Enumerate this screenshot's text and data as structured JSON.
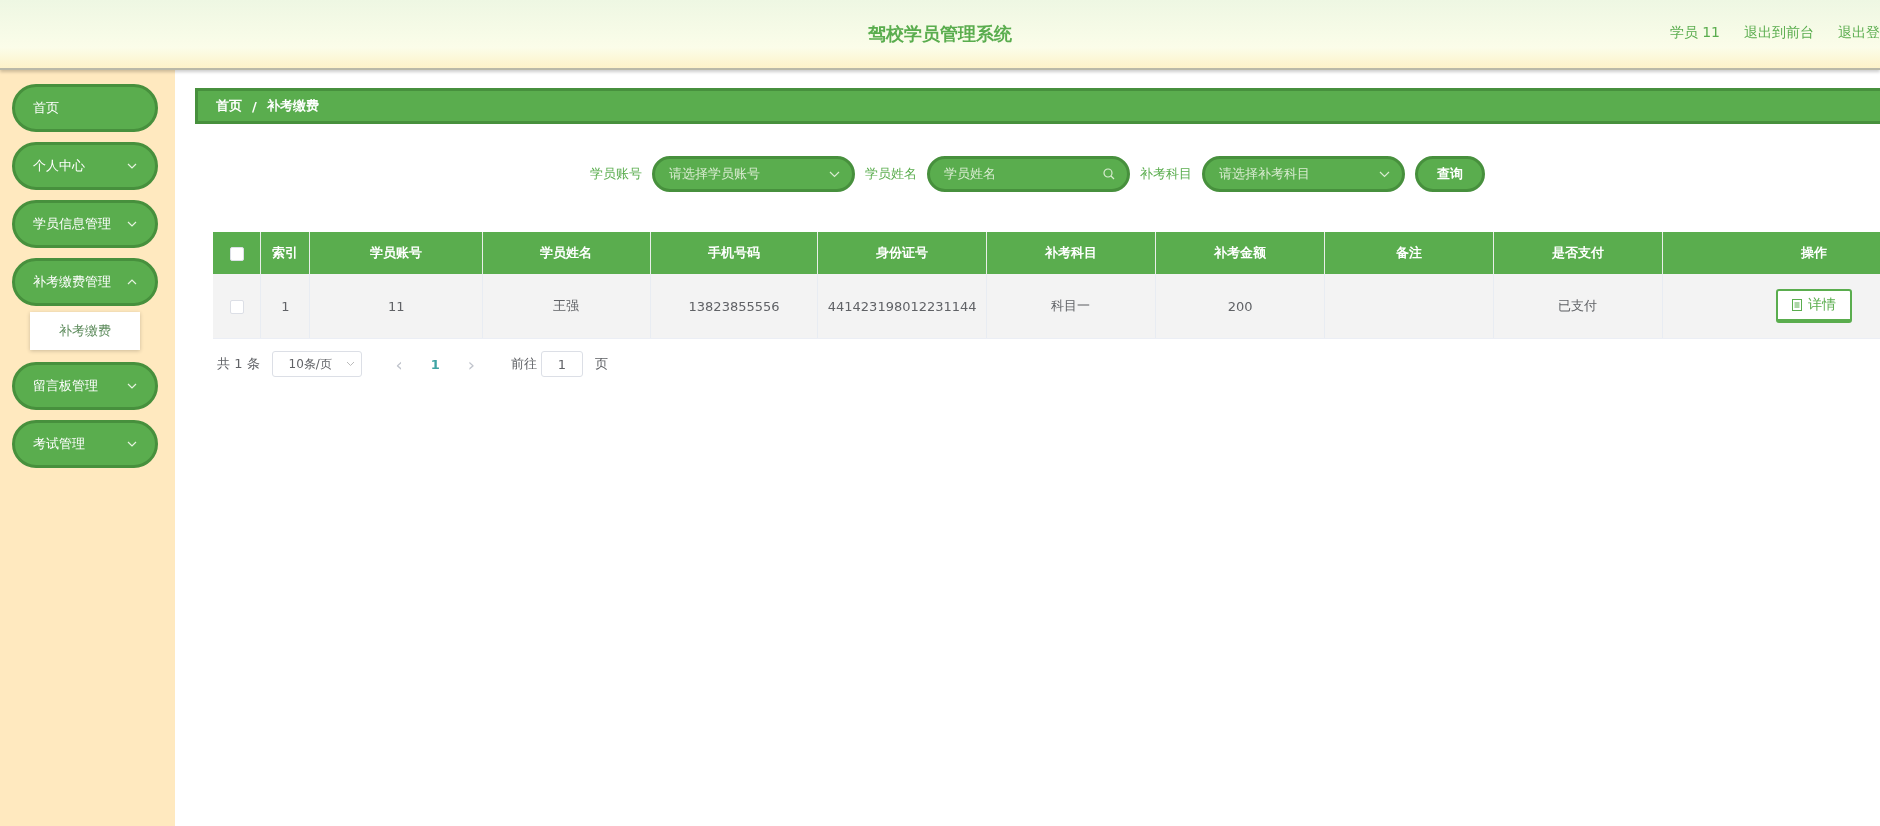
{
  "header": {
    "title": "驾校学员管理系统",
    "links": [
      "学员 11",
      "退出到前台",
      "退出登"
    ]
  },
  "sidebar": {
    "items": [
      {
        "label": "首页",
        "expanded": false,
        "has_children": false
      },
      {
        "label": "个人中心",
        "expanded": false,
        "has_children": true
      },
      {
        "label": "学员信息管理",
        "expanded": false,
        "has_children": true
      },
      {
        "label": "补考缴费管理",
        "expanded": true,
        "has_children": true,
        "children": [
          {
            "label": "补考缴费",
            "selected": true
          }
        ]
      },
      {
        "label": "留言板管理",
        "expanded": false,
        "has_children": true
      },
      {
        "label": "考试管理",
        "expanded": false,
        "has_children": true
      }
    ]
  },
  "breadcrumb": [
    "首页",
    "/",
    "补考缴费"
  ],
  "filters": [
    {
      "kind": "select",
      "label": "学员账号",
      "placeholder": "请选择学员账号"
    },
    {
      "kind": "search",
      "label": "学员姓名",
      "placeholder": "学员姓名"
    },
    {
      "kind": "select",
      "label": "补考科目",
      "placeholder": "请选择补考科目"
    }
  ],
  "query_button": "查询",
  "table": {
    "header_checked": false,
    "columns": [
      "索引",
      "学员账号",
      "学员姓名",
      "手机号码",
      "身份证号",
      "补考科目",
      "补考金额",
      "备注",
      "是否支付",
      "操作"
    ],
    "rows": [
      {
        "checked": false,
        "cells": [
          "1",
          "11",
          "王强",
          "13823855556",
          "441423198012231144",
          "科目一",
          "200",
          "",
          "已支付"
        ],
        "action": "详情"
      }
    ]
  },
  "pagination": {
    "total": "共 1 条",
    "page_size": "10条/页",
    "prev": "‹",
    "current": "1",
    "next": "›",
    "goto": "前往",
    "goto_value": "1",
    "page_unit": "页"
  }
}
